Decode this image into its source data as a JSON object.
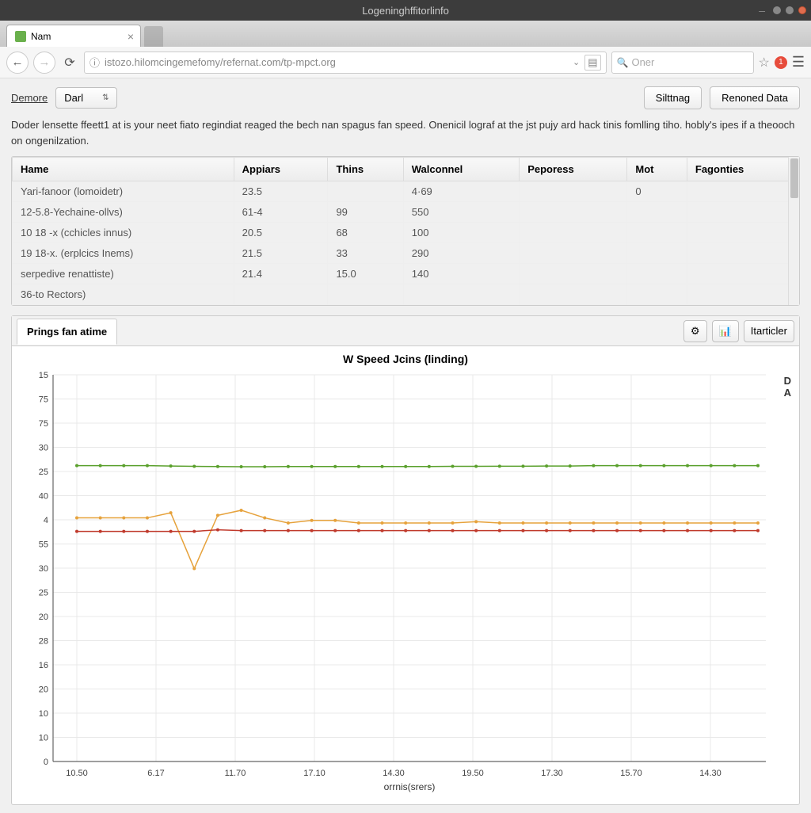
{
  "window": {
    "title": "Logeninghffitorlinfo"
  },
  "tab": {
    "label": "Nam"
  },
  "toolbar": {
    "url": "istozo.hilomcingemefomy/refernat.com/tp-mpct.org",
    "search_placeholder": "Oner",
    "badge_count": "1"
  },
  "controls": {
    "link": "Demore",
    "select_value": "Darl",
    "btn_settings": "Silttnag",
    "btn_reload": "Renoned Data"
  },
  "description": "Doder lensette ffeett1 at is your neet fiato regindiat reaged the bech nan spagus fan speed. Onenicil lograf at the jst pujy ard hack tinis fomlling tiho. hobly's ipes if a theooch on ongenilzation.",
  "table": {
    "headers": [
      "Hame",
      "Appiars",
      "Thins",
      "Walconnel",
      "Peporess",
      "Mot",
      "Fagonties"
    ],
    "rows": [
      [
        "Yari-fanoor (lomoidetr)",
        "23.5",
        "",
        "4·69",
        "",
        "0",
        ""
      ],
      [
        "12-5.8-Yechaine-ollvs)",
        "61-4",
        "99",
        "550",
        "",
        "",
        ""
      ],
      [
        "10 18 -x (cchicles innus)",
        "20.5",
        "68",
        "100",
        "",
        "",
        ""
      ],
      [
        "19 18-x. (erplcics Inems)",
        "21.5",
        "33",
        "290",
        "",
        "",
        ""
      ],
      [
        "serpedive renattiste)",
        "21.4",
        "15.0",
        "140",
        "",
        "",
        ""
      ],
      [
        "36-to Rectors)",
        "",
        "",
        "",
        "",
        "",
        ""
      ]
    ]
  },
  "chart_tab": {
    "label": "Prings fan atime",
    "btn_particler": "Itarticler"
  },
  "chart_data": {
    "type": "line",
    "title": "W Speed Jcins (linding)",
    "xlabel": "orrnis(srers)",
    "ylabel": "",
    "y_ticks": [
      "15",
      "75",
      "75",
      "30",
      "25",
      "40",
      "4",
      "55",
      "30",
      "25",
      "20",
      "28",
      "16",
      "20",
      "10",
      "10",
      "0"
    ],
    "x_ticks": [
      "10.50",
      "6.17",
      "11.70",
      "17.10",
      "14.30",
      "19.50",
      "17.30",
      "15.70",
      "14.30"
    ],
    "legend": [
      "D",
      "A"
    ],
    "series": [
      {
        "name": "green",
        "color": "#5aa02c",
        "values": [
          25,
          25,
          25,
          25,
          24.8,
          24.6,
          24.5,
          24.4,
          24.4,
          24.5,
          24.5,
          24.5,
          24.5,
          24.5,
          24.5,
          24.5,
          24.6,
          24.6,
          24.7,
          24.7,
          24.8,
          24.8,
          25,
          25,
          25,
          25,
          25,
          25,
          25,
          25
        ]
      },
      {
        "name": "orange",
        "color": "#e6a23c",
        "values": [
          40,
          40,
          40,
          40,
          42,
          20,
          41,
          43,
          40,
          38,
          39,
          39,
          38,
          38,
          38,
          38,
          38,
          38.5,
          38,
          38,
          38,
          38,
          38,
          38,
          38,
          38,
          38,
          38,
          38,
          38
        ]
      },
      {
        "name": "red",
        "color": "#c0392b",
        "values": [
          55,
          55,
          55,
          55,
          55,
          55,
          56,
          55.5,
          55.5,
          55.5,
          55.5,
          55.5,
          55.5,
          55.5,
          55.5,
          55.5,
          55.5,
          55.5,
          55.5,
          55.5,
          55.5,
          55.5,
          55.5,
          55.5,
          55.5,
          55.5,
          55.5,
          55.5,
          55.5,
          55.5
        ]
      }
    ]
  }
}
